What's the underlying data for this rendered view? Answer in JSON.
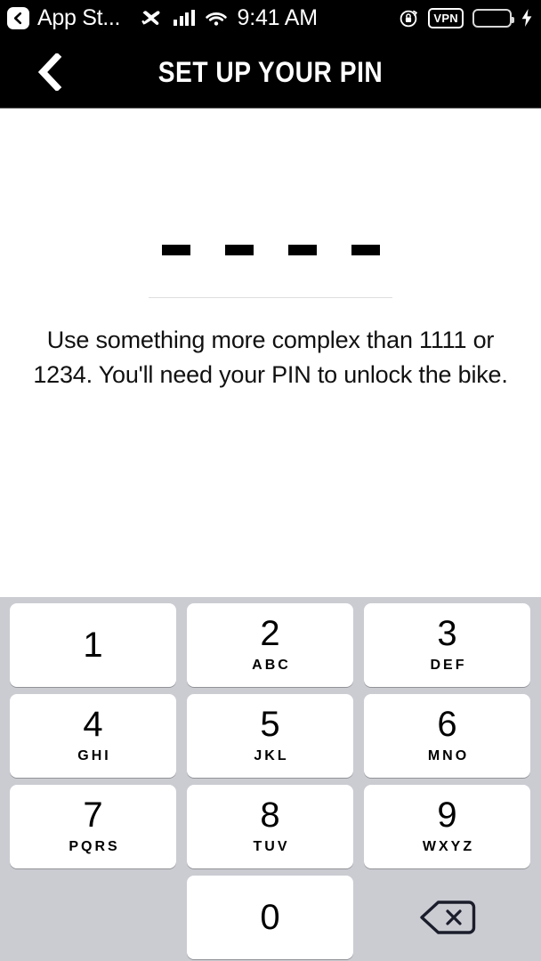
{
  "status_bar": {
    "back_chip_icon": "chevron-left-icon",
    "app_name": "App St...",
    "airplane_icon": "airplane-mode-icon",
    "signal_icon": "cellular-signal-icon",
    "wifi_icon": "wifi-icon",
    "time": "9:41 AM",
    "rotation_lock_icon": "rotation-lock-icon",
    "vpn_label": "VPN",
    "battery_icon": "battery-icon",
    "battery_color": "#4ce863",
    "charging_icon": "lightning-bolt-icon"
  },
  "navbar": {
    "back_icon": "chevron-left-icon",
    "title": "SET UP YOUR PIN",
    "background": "#000000",
    "text_color": "#ffffff"
  },
  "pin_entry": {
    "digit_count": 4,
    "entered": "",
    "placeholder_glyph": "dash",
    "hint": "Use something more complex than 1111 or 1234. You'll need your PIN to unlock the bike."
  },
  "keypad": {
    "background": "#cbccd2",
    "key_background": "#ffffff",
    "rows": [
      [
        {
          "digit": "1",
          "letters": ""
        },
        {
          "digit": "2",
          "letters": "ABC"
        },
        {
          "digit": "3",
          "letters": "DEF"
        }
      ],
      [
        {
          "digit": "4",
          "letters": "GHI"
        },
        {
          "digit": "5",
          "letters": "JKL"
        },
        {
          "digit": "6",
          "letters": "MNO"
        }
      ],
      [
        {
          "digit": "7",
          "letters": "PQRS"
        },
        {
          "digit": "8",
          "letters": "TUV"
        },
        {
          "digit": "9",
          "letters": "WXYZ"
        }
      ]
    ],
    "bottom_row": {
      "zero": {
        "digit": "0",
        "letters": ""
      },
      "delete_icon": "backspace-delete-icon"
    }
  }
}
